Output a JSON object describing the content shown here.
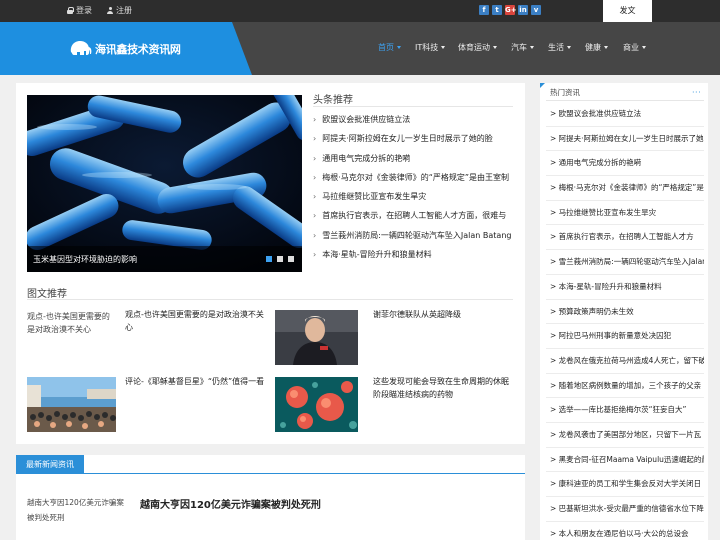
{
  "topbar": {
    "login": "登录",
    "register": "注册",
    "social": [
      "f",
      "t",
      "G+",
      "in",
      "v"
    ],
    "post_button": "发文"
  },
  "logo": {
    "text": "海讯鑫技术资讯网"
  },
  "nav": [
    {
      "label": "首页",
      "active": true
    },
    {
      "label": "IT科技",
      "active": false
    },
    {
      "label": "体育运动",
      "active": false
    },
    {
      "label": "汽车",
      "active": false
    },
    {
      "label": "生活",
      "active": false
    },
    {
      "label": "健康",
      "active": false
    },
    {
      "label": "商业",
      "active": false
    }
  ],
  "slider": {
    "caption": "玉米基因型对环境胁迫的影响",
    "dots": 3,
    "active_dot": 0
  },
  "headlines": {
    "title": "头条推荐",
    "items": [
      "欧盟议会批准供应链立法",
      "阿提夫·阿斯拉姆在女儿一岁生日时展示了她的脸",
      "通用电气完成分拆的艳嗬",
      "梅根·马克尔对《金装律师》的“严格规定”是由王室制",
      "马拉维继赞比亚宣布发生旱灾",
      "首席执行官表示，在招聘人工智能人才方面，很难与",
      "雪兰莪州消防局:一辆四轮驱动汽车坠入Jalan Batang",
      "本海·星轨-冒险升升和狼量材料"
    ]
  },
  "pictures": {
    "title": "图文推荐",
    "items": [
      {
        "alt": "观点-也许美国更需要的是对政治漠不关心",
        "text": "观点-也许美国更需要的是对政治漠不关心"
      },
      {
        "alt": "",
        "text": "谢菲尔德联队从英超降级"
      },
      {
        "alt": "",
        "text": "评论-《耶稣基督巨星》“仍然”值得一看"
      },
      {
        "alt": "",
        "text": "这些发现可能会导致在生命周期的休眠阶段瞄准结核病的药物"
      }
    ]
  },
  "latest_news": {
    "badge": "最新新闻资讯",
    "alt": "越南大亨因120亿美元诈骗案被判处死刑",
    "title": "越南大亨因120亿美元诈骗案被判处死刑"
  },
  "sidebar": {
    "title": "热门资讯",
    "more": "···",
    "items": [
      "> 欧盟议会批准供应链立法",
      "> 阿提夫·阿斯拉姆在女儿一岁生日时展示了她的脸",
      "> 通用电气完成分拆的艳嗬",
      "> 梅根·马克尔对《金装律师》的“严格规定”是",
      "> 马拉维继赞比亚宣布发生旱灾",
      "> 首席执行官表示，在招聘人工智能人才方",
      "> 雪兰莪州消防局:一辆四轮驱动汽车坠入Jalan",
      "> 本海-星轨-冒险升升和狼量材料",
      "> 预算政策声明仍未生效",
      "> 阿拉巴马州刑事的新量意处决囚犯",
      "> 龙卷风在俄克拉荷马州造成4人死亡，留下破",
      "> 随着地区病例数量的增加，三个孩子的父亲",
      "> 选举——库比基拒绝梅尔茨“狂妄自大”",
      "> 龙卷风袭击了美国部分地区，只留下一片瓦",
      "> 黑麦合同-征召Maama Vaipulu迅速崛起的最",
      "> 康科迪亚的员工和学生集会反对大学关闭日",
      "> 巴基斯坦洪水-受灾最严重的信德省水位下降",
      "> 本人和朋友在通尼伯以马·大公的总设会"
    ]
  }
}
